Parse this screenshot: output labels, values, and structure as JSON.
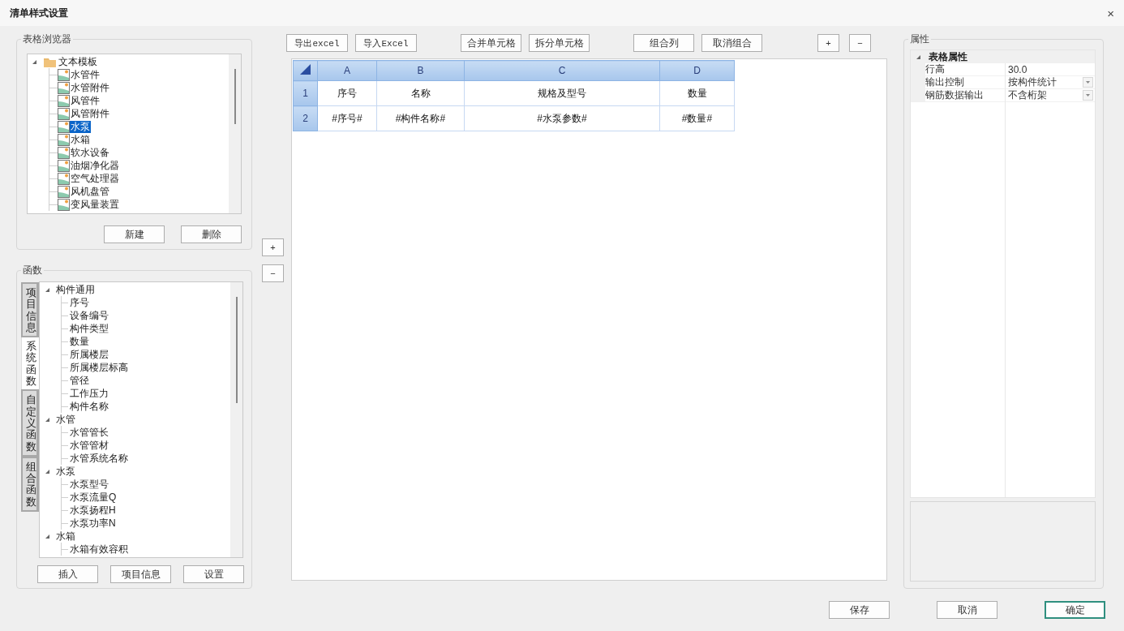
{
  "window": {
    "title": "清单样式设置",
    "close": "×"
  },
  "browser": {
    "title": "表格浏览器",
    "tree": [
      {
        "label": "文本模板",
        "expanded": true,
        "children": [
          {
            "label": "水管件",
            "selected": false
          },
          {
            "label": "水管附件",
            "selected": false
          },
          {
            "label": "风管件",
            "selected": false
          },
          {
            "label": "风管附件",
            "selected": false
          },
          {
            "label": "水泵",
            "selected": true
          },
          {
            "label": "水箱",
            "selected": false
          },
          {
            "label": "软水设备",
            "selected": false
          },
          {
            "label": "油烟净化器",
            "selected": false
          },
          {
            "label": "空气处理器",
            "selected": false
          },
          {
            "label": "风机盘管",
            "selected": false
          },
          {
            "label": "变风量装置",
            "selected": false
          }
        ]
      }
    ],
    "buttons": [
      "新建",
      "删除"
    ]
  },
  "functions": {
    "title": "函数",
    "tabs": [
      {
        "label": "项目信息",
        "selected": false
      },
      {
        "label": "系统函数",
        "selected": true
      },
      {
        "label": "自定义函数",
        "selected": false
      },
      {
        "label": "组合函数",
        "selected": false
      }
    ],
    "tree": [
      {
        "label": "构件通用",
        "expanded": true,
        "children": [
          "序号",
          "设备编号",
          "构件类型",
          "数量",
          "所属楼层",
          "所属楼层标高",
          "管径",
          "工作压力",
          "构件名称"
        ]
      },
      {
        "label": "水管",
        "expanded": true,
        "children": [
          "水管管长",
          "水管管材",
          "水管系统名称"
        ]
      },
      {
        "label": "水泵",
        "expanded": true,
        "children": [
          "水泵型号",
          "水泵流量Q",
          "水泵扬程H",
          "水泵功率N"
        ]
      },
      {
        "label": "水箱",
        "expanded": true,
        "children": [
          "水箱有效容积"
        ]
      }
    ],
    "buttons": [
      "插入",
      "项目信息",
      "设置"
    ]
  },
  "side_buttons": [
    "+",
    "−"
  ],
  "toolbar": [
    [
      "导出excel",
      "导入Excel"
    ],
    [
      "合并单元格",
      "拆分单元格"
    ],
    [
      "组合列",
      "取消组合"
    ],
    [
      "+",
      "−"
    ]
  ],
  "sheet": {
    "columns": [
      "A",
      "B",
      "C",
      "D"
    ],
    "rows": [
      {
        "header": "1",
        "cells": [
          "序号",
          "名称",
          "规格及型号",
          "数量"
        ]
      },
      {
        "header": "2",
        "cells": [
          "#序号#",
          "#构件名称#",
          "#水泵参数#",
          "#数量#"
        ]
      }
    ]
  },
  "properties": {
    "title": "属性",
    "category": {
      "label": "表格属性",
      "expanded": true,
      "rows": [
        {
          "name": "行高",
          "value": "30.0",
          "kind": "text"
        },
        {
          "name": "输出控制",
          "value": "按构件统计",
          "kind": "dropdown"
        },
        {
          "name": "钢筋数据输出",
          "value": "不含桁架",
          "kind": "dropdown"
        }
      ]
    }
  },
  "footer_buttons": [
    {
      "label": "保存",
      "default": false
    },
    {
      "label": "取消",
      "default": false
    },
    {
      "label": "确定",
      "default": true
    }
  ]
}
